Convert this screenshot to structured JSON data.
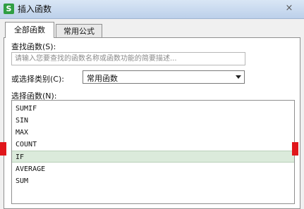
{
  "window": {
    "title": "插入函数",
    "app_icon_glyph": "S",
    "close_glyph": "×"
  },
  "tabs": [
    {
      "label": "全部函数",
      "active": true
    },
    {
      "label": "常用公式",
      "active": false
    }
  ],
  "search": {
    "label": "查找函数(S):",
    "placeholder": "请输入您要查找的函数名称或函数功能的简要描述..."
  },
  "category": {
    "label": "或选择类别(C):",
    "selected": "常用函数"
  },
  "function_list": {
    "label": "选择函数(N):",
    "items": [
      "SUMIF",
      "SIN",
      "MAX",
      "COUNT",
      "IF",
      "AVERAGE",
      "SUM"
    ],
    "selected_index": 4
  },
  "colors": {
    "highlight_mark": "#e0161b",
    "selection_bg": "#dbeadb",
    "titlebar": "#bcd0ea"
  },
  "icons": [
    "app-logo-icon",
    "close-icon",
    "chevron-down-icon"
  ]
}
